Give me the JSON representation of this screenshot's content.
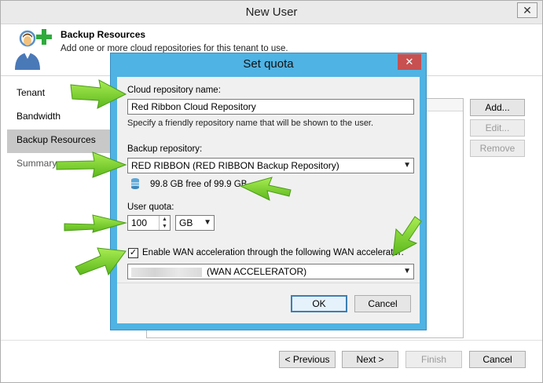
{
  "window": {
    "title": "New User",
    "close_glyph": "✕"
  },
  "header": {
    "title": "Backup Resources",
    "description": "Add one or more cloud repositories for this tenant to use.",
    "icon": "user-add-icon"
  },
  "nav": {
    "items": [
      {
        "label": "Tenant",
        "state": "normal"
      },
      {
        "label": "Bandwidth",
        "state": "normal"
      },
      {
        "label": "Backup Resources",
        "state": "active"
      },
      {
        "label": "Summary",
        "state": "dim"
      }
    ]
  },
  "side_buttons": {
    "add": "Add...",
    "edit": "Edit...",
    "remove": "Remove"
  },
  "footer": {
    "previous": "< Previous",
    "next": "Next >",
    "finish": "Finish",
    "cancel": "Cancel"
  },
  "dialog": {
    "title": "Set quota",
    "close_glyph": "✕",
    "repo_name_label": "Cloud repository name:",
    "repo_name_value": "Red Ribbon Cloud Repository",
    "repo_name_hint": "Specify a friendly repository name that will be shown to the user.",
    "backup_repo_label": "Backup repository:",
    "backup_repo_value": "RED RIBBON (RED RIBBON Backup Repository)",
    "free_space": "99.8 GB free of 99.9 GB",
    "quota_label": "User quota:",
    "quota_value": "100",
    "quota_unit": "GB",
    "wan_checkbox_checked": true,
    "wan_checkbox_label": "Enable WAN acceleration through the following WAN accelerator:",
    "wan_accelerator_value": "(WAN ACCELERATOR)",
    "ok": "OK",
    "cancel": "Cancel"
  },
  "colors": {
    "dialog_frame": "#4fb3e3",
    "close_button": "#c75050",
    "annotation_arrow": "#7ed321",
    "nav_active": "#c8c8c8"
  }
}
